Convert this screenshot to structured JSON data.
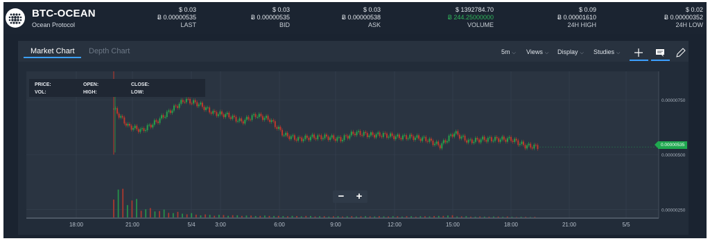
{
  "header": {
    "pair": "BTC-OCEAN",
    "coin_name": "Ocean Protocol",
    "stats": [
      {
        "usd": "$ 0.03",
        "btc": "Ƀ 0.00000535",
        "label": "LAST"
      },
      {
        "usd": "$ 0.03",
        "btc": "Ƀ 0.00000535",
        "label": "BID"
      },
      {
        "usd": "$ 0.03",
        "btc": "Ƀ 0.00000538",
        "label": "ASK"
      },
      {
        "usd": "$ 1392784.70",
        "btc": "Ƀ 244.25000000",
        "label": "VOLUME"
      },
      {
        "usd": "$ 0.09",
        "btc": "Ƀ 0.00001610",
        "label": "24H HIGH"
      },
      {
        "usd": "$ 0.02",
        "btc": "Ƀ 0.00000352",
        "label": "24H LOW"
      }
    ]
  },
  "tabs": {
    "market": "Market Chart",
    "depth": "Depth Chart"
  },
  "toolbar": {
    "interval": "5m",
    "views": "Views",
    "display": "Display",
    "studies": "Studies"
  },
  "icons": {
    "crosshair": "crosshair-icon",
    "comment": "comment-icon",
    "draw": "pencil-icon",
    "logo": "ocean-logo-icon",
    "zoom_out": "minus-icon",
    "zoom_in": "plus-icon"
  },
  "ohlc_labels": {
    "price": "PRICE:",
    "open": "OPEN:",
    "close": "CLOSE:",
    "vol": "VOL:",
    "high": "HIGH:",
    "low": "LOW:"
  },
  "zoom": {
    "minus": "−",
    "plus": "+"
  },
  "colors": {
    "up": "#26a24b",
    "down": "#c0392b",
    "accent": "#3ca0ff",
    "price_tag": "#1fa84f",
    "background": "#1a2330"
  },
  "chart_data": {
    "type": "candlestick",
    "x_ticks": [
      "18:00",
      "21:00",
      "5/4",
      "3:00",
      "6:00",
      "9:00",
      "12:00",
      "15:00",
      "18:00",
      "21:00",
      "5/5"
    ],
    "y_ticks": [
      "0.00000750",
      "0.00000500",
      "0.00000250"
    ],
    "y_ticks_values": [
      7.5e-06,
      5e-06,
      2.5e-06
    ],
    "ylim": [
      2.1e-06,
      8.8e-06
    ],
    "current_price_label": "0.00000535",
    "current_price": 5.35e-06,
    "grid": true,
    "series": [
      {
        "x": [
          "20:00",
          "20:30",
          "21:00",
          "21:30",
          "22:00",
          "22:30",
          "23:00",
          "23:30",
          "00:00",
          "01:00",
          "02:00",
          "03:00",
          "04:00",
          "05:00",
          "06:00",
          "07:00",
          "08:00",
          "09:00",
          "10:00",
          "11:00",
          "12:00",
          "13:00",
          "14:00",
          "15:00",
          "15:30",
          "16:00",
          "16:30",
          "17:00",
          "18:00",
          "19:00",
          "19:30"
        ],
        "close": [
          7.1e-06,
          6.3e-06,
          6.1e-06,
          6.5e-06,
          7e-06,
          7.5e-06,
          7.3e-06,
          6.9e-06,
          6.8e-06,
          6.5e-06,
          6.8e-06,
          6.6e-06,
          5.9e-06,
          5.7e-06,
          5.8e-06,
          5.8e-06,
          5.7e-06,
          6e-06,
          5.9e-06,
          5.9e-06,
          5.8e-06,
          5.8e-06,
          5.7e-06,
          5.4e-06,
          6e-06,
          5.6e-06,
          5.7e-06,
          5.7e-06,
          5.7e-06,
          5.4e-06,
          5.35e-06
        ]
      }
    ],
    "volume": [
      95,
      60,
      30,
      25,
      18,
      14,
      10,
      9,
      8,
      7,
      6,
      6,
      5,
      5,
      5,
      4,
      4,
      4,
      4,
      4,
      4,
      4,
      4,
      5,
      7,
      4,
      3,
      3,
      3,
      2,
      2
    ]
  }
}
